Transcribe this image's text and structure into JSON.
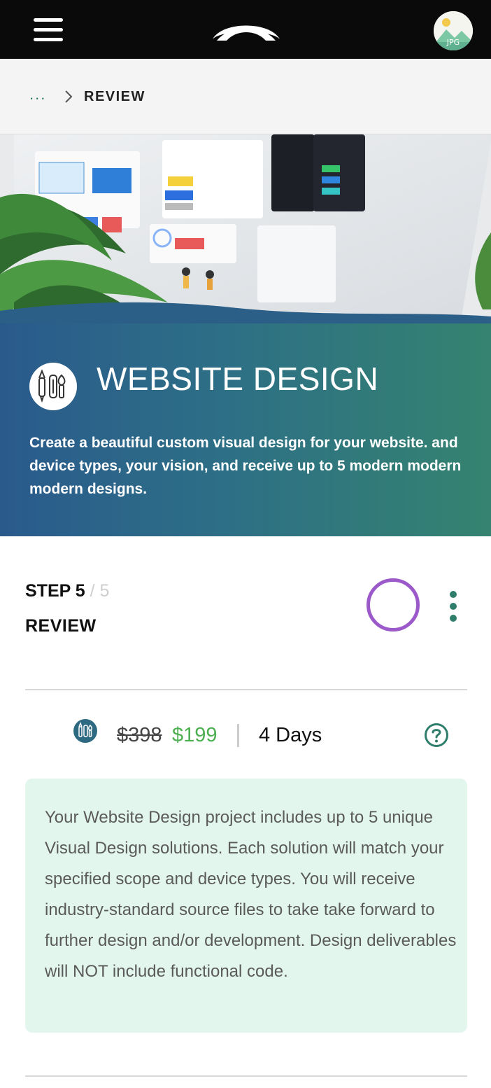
{
  "header": {
    "menu_icon": "hamburger-icon",
    "logo_icon": "brand-logo",
    "avatar_label": "JPG"
  },
  "breadcrumb": {
    "ellipsis": "...",
    "current": "REVIEW"
  },
  "hero": {
    "title": "WEBSITE DESIGN",
    "description": "Create a beautiful custom visual design for your website. and device types, your vision, and receive up to 5 modern modern modern designs.",
    "icon": "design-tools-icon"
  },
  "step": {
    "prefix": "STEP 5",
    "total": " / 5",
    "name": "REVIEW"
  },
  "pricing": {
    "old_price": "$398",
    "new_price": "$199",
    "duration": "4 Days"
  },
  "info": {
    "text": "Your Website Design project includes up to 5 unique Visual Design solutions. Each solution will match your specified scope and device types. You will receive industry-standard source files to take take forward to further design and/or development. Design deliverables will NOT include functional code."
  },
  "colors": {
    "accent_green": "#2f7d6b",
    "price_green": "#4caf50",
    "progress_purple": "#9b59c9",
    "info_bg": "#e3f6ee"
  }
}
